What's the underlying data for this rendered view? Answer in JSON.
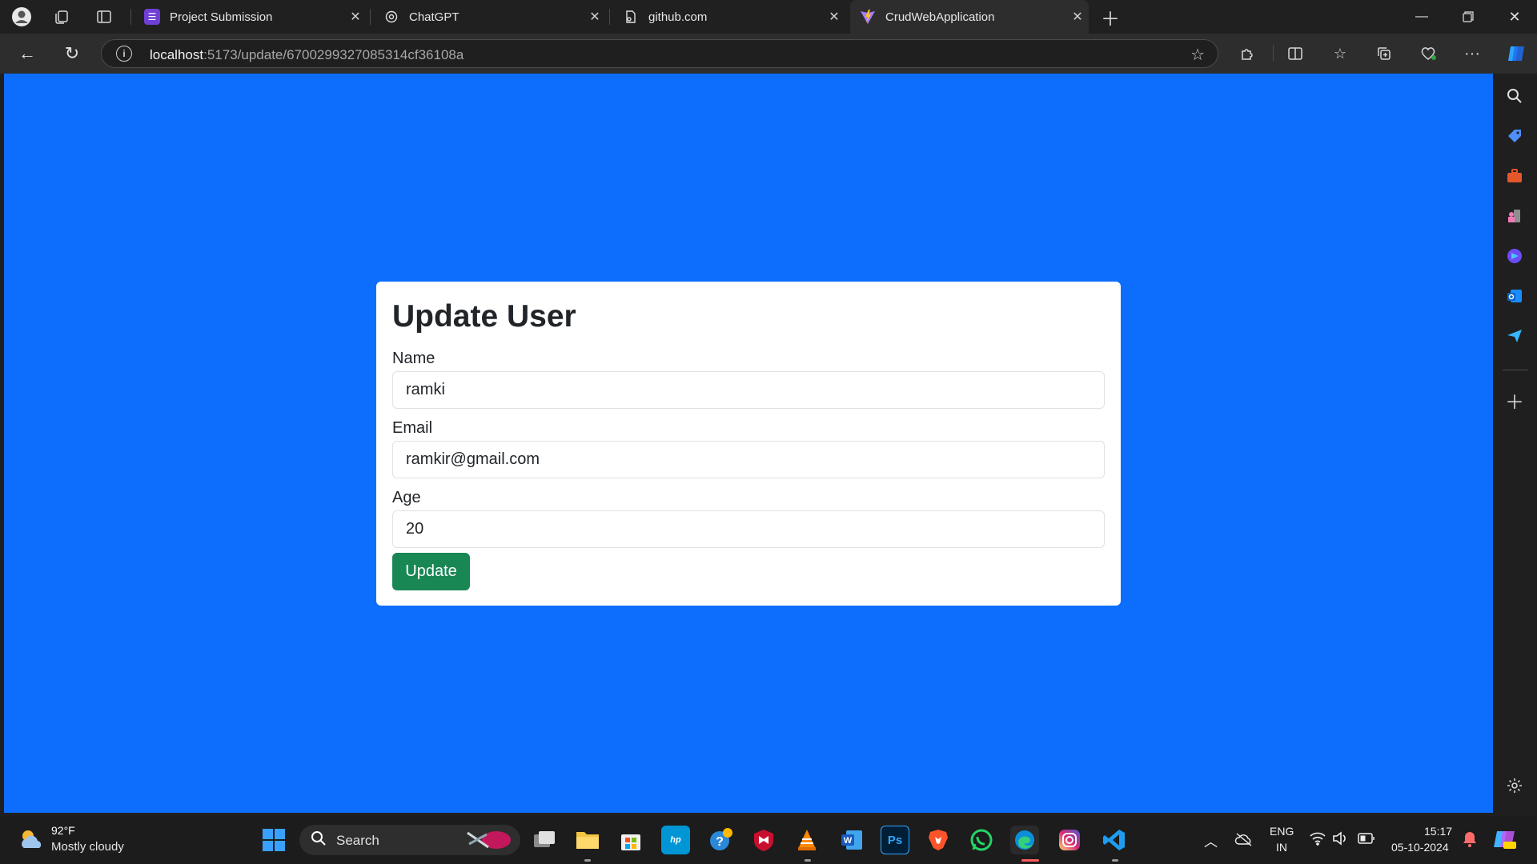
{
  "browser": {
    "tabs": [
      {
        "title": "Project Submission",
        "favicon": "form-icon",
        "color": "#6f3fd6"
      },
      {
        "title": "ChatGPT",
        "favicon": "chatgpt-icon",
        "color": "#202020"
      },
      {
        "title": "github.com",
        "favicon": "page-icon",
        "color": "#202020"
      },
      {
        "title": "CrudWebApplication",
        "favicon": "vite-icon",
        "color": "#9b59ff"
      }
    ],
    "active_tab_index": 3,
    "url": {
      "host": "localhost",
      "path": ":5173/update/6700299327085314cf36108a"
    }
  },
  "form": {
    "heading": "Update User",
    "name_label": "Name",
    "name_value": "ramki",
    "email_label": "Email",
    "email_value": "ramkir@gmail.com",
    "age_label": "Age",
    "age_value": "20",
    "submit_label": "Update"
  },
  "colors": {
    "page_background": "#0d6efd",
    "button": "#198754"
  },
  "taskbar": {
    "weather_temp": "92°F",
    "weather_desc": "Mostly cloudy",
    "search_label": "Search",
    "lang_top": "ENG",
    "lang_bottom": "IN",
    "time": "15:17",
    "date": "05-10-2024"
  }
}
